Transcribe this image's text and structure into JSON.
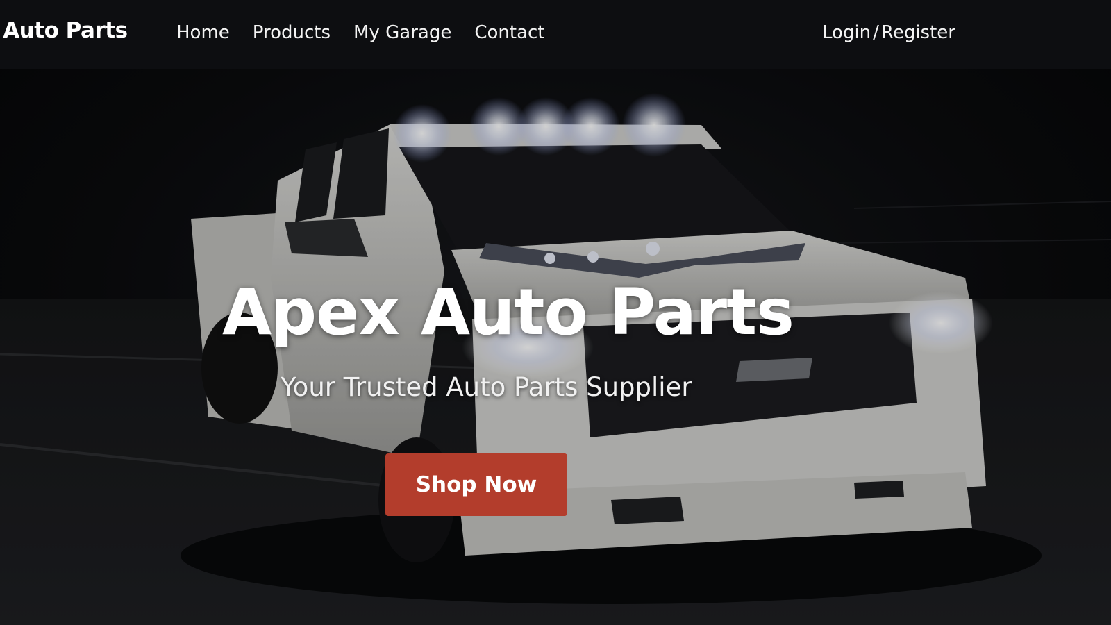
{
  "navbar": {
    "brand": ": Auto Parts",
    "links": [
      {
        "label": "Home"
      },
      {
        "label": "Products"
      },
      {
        "label": "My Garage"
      },
      {
        "label": "Contact"
      }
    ],
    "auth": {
      "login": "Login",
      "separator": "/",
      "register": "Register"
    }
  },
  "hero": {
    "title": "Apex Auto Parts",
    "subtitle": "Your Trusted Auto Parts Supplier",
    "cta_label": "Shop Now",
    "background_image": "white pickup truck at night with roof lights"
  },
  "colors": {
    "navbar_bg": "#0d0e11",
    "cta_bg": "#b33d2c",
    "text": "#ffffff"
  }
}
